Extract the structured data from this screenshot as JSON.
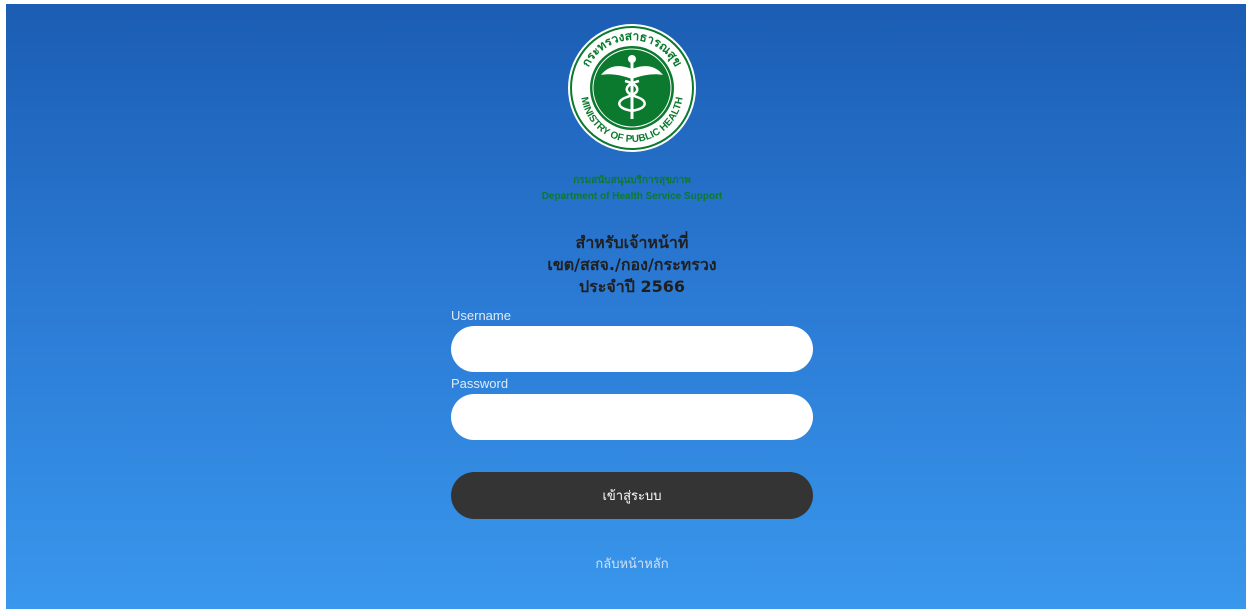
{
  "logo": {
    "seal_text_top": "กระทรวงสาธารณสุข",
    "seal_text_bottom": "MINISTRY OF PUBLIC HEALTH",
    "icon": "caduceus-seal-icon"
  },
  "department": {
    "name_th": "กรมสนับสนุนบริการสุขภาพ",
    "name_en": "Department of Health Service Support"
  },
  "heading": {
    "line1": "สำหรับเจ้าหน้าที่",
    "line2": "เขต/สสจ./กอง/กระทรวง",
    "line3": "ประจำปี 2566"
  },
  "form": {
    "username_label": "Username",
    "username_value": "",
    "password_label": "Password",
    "password_value": "",
    "login_label": "เข้าสู่ระบบ"
  },
  "back_link": "กลับหน้าหลัก",
  "colors": {
    "gradient_top": "#1b5db3",
    "gradient_bottom": "#3997ec",
    "seal_green": "#0b7a2e",
    "button": "#343434"
  }
}
